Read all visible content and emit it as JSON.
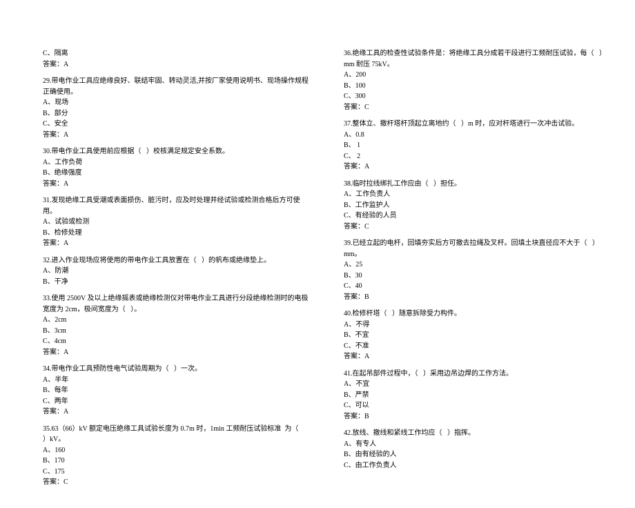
{
  "left": [
    {
      "stem": "C、隔离",
      "opts": [],
      "ans": "答案：A"
    },
    {
      "stem": "29.带电作业工具应绝缘良好、联结牢固、转动灵活,并按厂家使用说明书、现场操作规程正确使用。",
      "opts": [
        "A、现场",
        "B、部分",
        "C、安全"
      ],
      "ans": "答案：A"
    },
    {
      "stem": "30.带电作业工具使用前应根据（   ）校核满足规定安全系数。",
      "opts": [
        "A、工作负荷",
        "B、绝缘强度"
      ],
      "ans": "答案：A"
    },
    {
      "stem": "31.发现绝缘工具受潮或表面损伤、脏污时，应及时处理并经试验或检测合格后方可使用。",
      "opts": [
        "A、试验或检测",
        "B、检修处理"
      ],
      "ans": "答案：A"
    },
    {
      "stem": "32.进入作业现场应将使用的带电作业工具放置在（   ）的帆布或绝缘垫上。",
      "opts": [
        "A、防潮",
        "B、干净"
      ],
      "ans": ""
    },
    {
      "stem": "33.使用 2500V 及以上绝缘摇表或绝缘检测仪对带电作业工具进行分段绝缘检测时的电极宽度为 2cm，极间宽度为（   ）。",
      "opts": [
        "A、2cm",
        "B、3cm",
        "C、4cm"
      ],
      "ans": "答案：A"
    },
    {
      "stem": "34.带电作业工具预防性电气试验周期为（   ）一次。",
      "opts": [
        "A、半年",
        "B、每年",
        "C、两年"
      ],
      "ans": "答案：A"
    },
    {
      "stem": "35.63（66）kV 额定电压绝缘工具试验长度为 0.7m 时，1min 工频耐压试验标准  为（     ）kV。",
      "opts": [
        "A、160",
        "B、170",
        "C、175"
      ],
      "ans": "答案：C"
    }
  ],
  "right": [
    {
      "stem": "36.绝缘工具的检查性试验条件是：将绝缘工具分成若干段进行工频耐压试验，每（   ）mm 耐压 75kV。",
      "opts": [
        "A、200",
        "B、100",
        "C、300"
      ],
      "ans": "答案：C"
    },
    {
      "stem": "37.整体立、撤杆塔杆顶起立离地约（   ）m 时，应对杆塔进行一次冲击试验。",
      "opts": [
        "A、0.8",
        "B、 1",
        "C、 2"
      ],
      "ans": "答案：A"
    },
    {
      "stem": "38.临时拉线绑扎工作应由（   ）担任。",
      "opts": [
        "A、工作负责人",
        "B、工作监护人",
        "C、有经验的人员"
      ],
      "ans": "答案：C"
    },
    {
      "stem": "39.已经立起的电杆，回填夯实后方可撤去拉绳及叉杆。回填土块直径应不大于（   ）mm。",
      "opts": [
        "A、25",
        "B、30",
        "C、40"
      ],
      "ans": "答案：B"
    },
    {
      "stem": "40.检修杆塔（   ）随意拆除受力构件。",
      "opts": [
        "A、不得",
        "B、不宜",
        "C、不准"
      ],
      "ans": "答案：A"
    },
    {
      "stem": "41.在起吊部件过程中，（   ）采用边吊边焊的工作方法。",
      "opts": [
        "A、不宜",
        "B、严禁",
        "C、可以"
      ],
      "ans": "答案：B"
    },
    {
      "stem": "42.放线、撤线和紧线工作均应（   ）指挥。",
      "opts": [
        "A、有专人",
        "B、由有经验的人",
        "C、由工作负责人"
      ],
      "ans": ""
    }
  ]
}
